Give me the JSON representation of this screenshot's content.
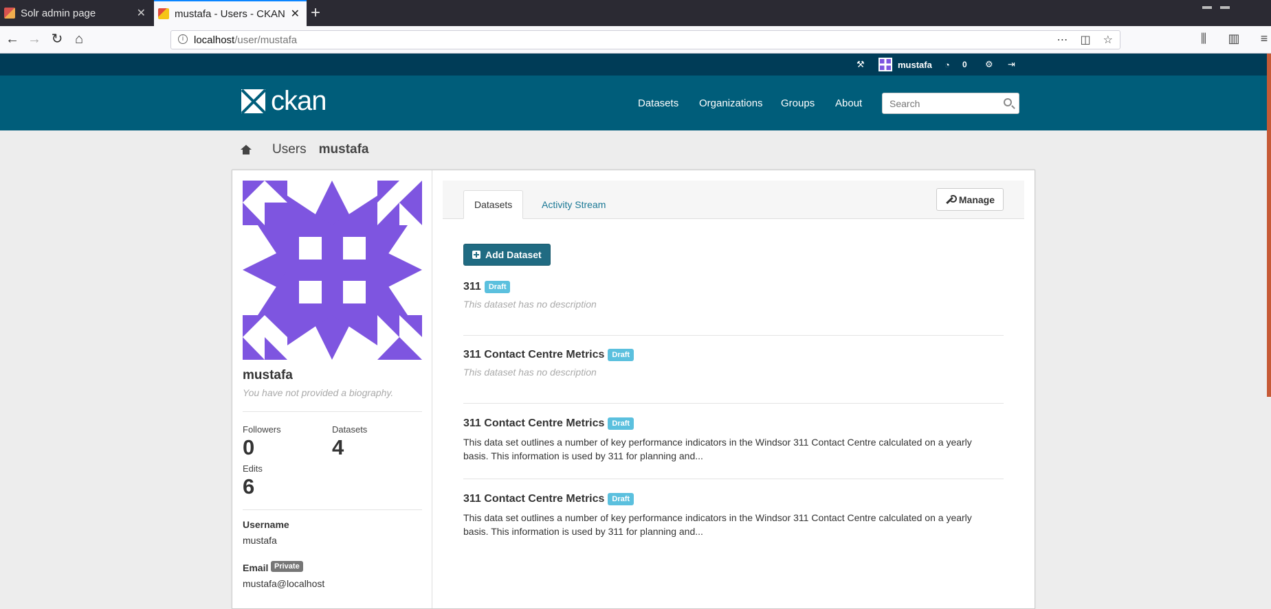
{
  "browser": {
    "tabs": [
      {
        "title": "Solr admin page"
      },
      {
        "title": "mustafa - Users - CKAN"
      }
    ],
    "url": {
      "host": "localhost",
      "path": "/user/mustafa"
    }
  },
  "account": {
    "username": "mustafa",
    "dashboard_count": "0"
  },
  "header": {
    "logo_text": "ckan",
    "nav": [
      "Datasets",
      "Organizations",
      "Groups",
      "About"
    ],
    "search_placeholder": "Search"
  },
  "breadcrumb": {
    "users": "Users",
    "current": "mustafa"
  },
  "user": {
    "name": "mustafa",
    "bio_placeholder": "You have not provided a biography.",
    "stats": {
      "followers_label": "Followers",
      "followers": "0",
      "datasets_label": "Datasets",
      "datasets": "4",
      "edits_label": "Edits",
      "edits": "6"
    },
    "username_label": "Username",
    "username": "mustafa",
    "email_label": "Email",
    "email_badge": "Private",
    "email": "mustafa@localhost"
  },
  "primary": {
    "tabs": [
      "Datasets",
      "Activity Stream"
    ],
    "manage_label": "Manage",
    "add_dataset_label": "Add Dataset",
    "datasets": [
      {
        "title": "311",
        "badge": "Draft",
        "description": "This dataset has no description"
      },
      {
        "title": "311 Contact Centre Metrics",
        "badge": "Draft",
        "description": "This dataset has no description"
      },
      {
        "title": "311 Contact Centre Metrics",
        "badge": "Draft",
        "notes": "This data set outlines a number of key performance indicators in the Windsor 311 Contact Centre calculated on a yearly basis. This information is used by 311 for planning and..."
      },
      {
        "title": "311 Contact Centre Metrics",
        "badge": "Draft",
        "notes": "This data set outlines a number of key performance indicators in the Windsor 311 Contact Centre calculated on a yearly basis. This information is used by 311 for planning and..."
      }
    ]
  },
  "colors": {
    "masthead": "#005d7a",
    "account_bar": "#003c57",
    "avatar": "#7e55e0",
    "draft": "#5bc0de",
    "primary_button": "#206b82"
  }
}
